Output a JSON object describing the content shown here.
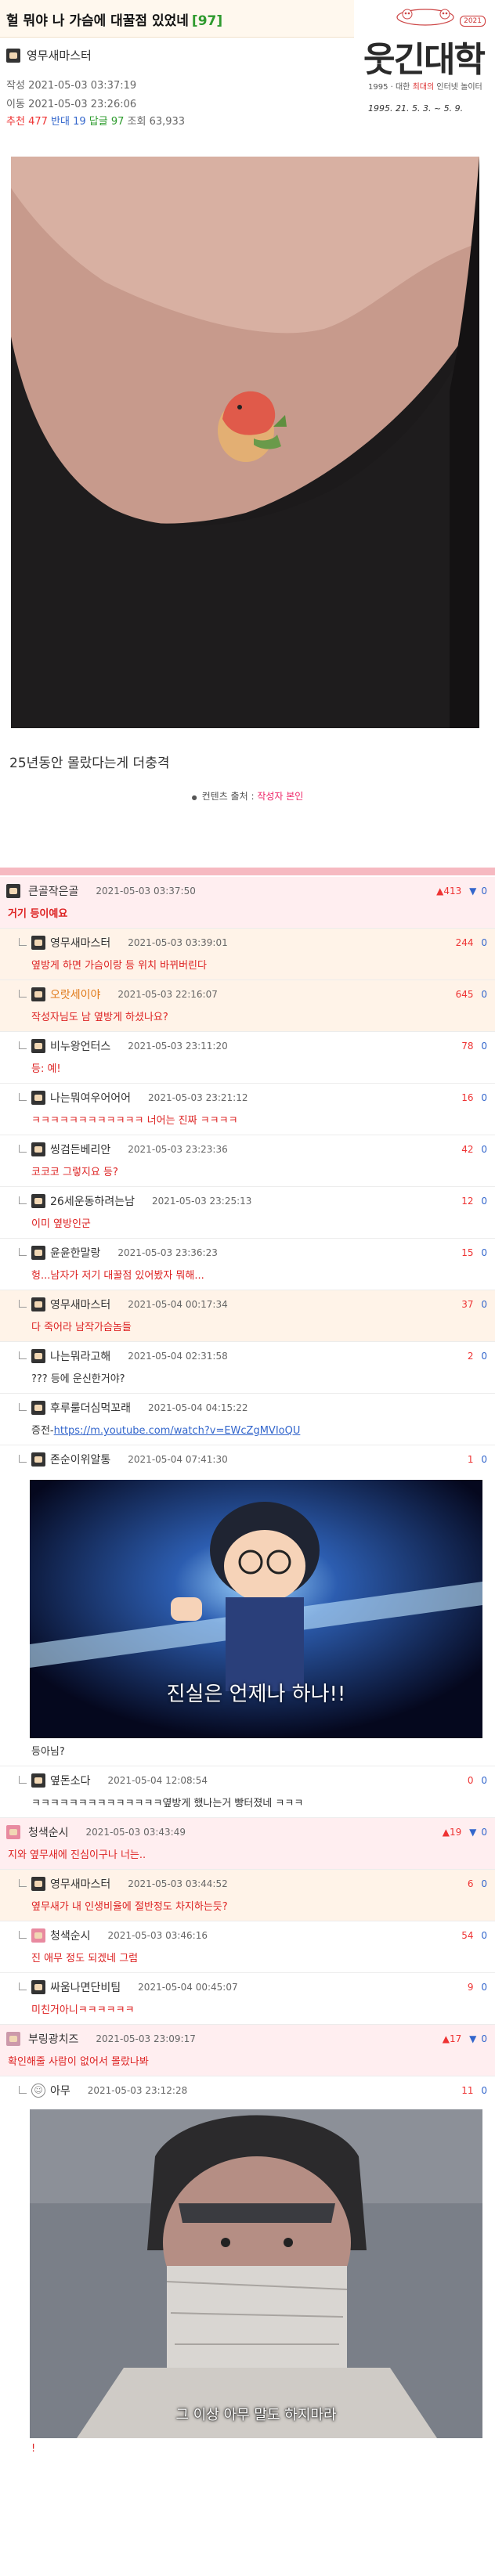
{
  "post": {
    "title": "헐 뭐야 나 가슴에 대꿀점 있었네",
    "comment_count": "[97]",
    "author": "영무새마스터",
    "created_label": "작성",
    "created": "2021-05-03 03:37:19",
    "moved_label": "이동",
    "moved": "2021-05-03 23:26:06",
    "recommend_label": "추천",
    "recommend": "477",
    "oppose_label": "반대",
    "oppose": "19",
    "reply_label": "답글",
    "reply": "97",
    "views_label": "조회",
    "views": "63,933",
    "caption": "25년동안 몰랐다는게 더충격",
    "source_label": "컨텐츠 출처 :",
    "source_value": "작성자 본인"
  },
  "logo": {
    "name": "웃긴대학",
    "badge": "2021",
    "slogan_pre": "1995 · 대한 ",
    "slogan_red": "최대의",
    "slogan_post": " 인터넷 놀이터",
    "date": "1995. 21. 5. 3. ~ 5. 9."
  },
  "comments": [
    {
      "nick": "큰골작은골",
      "time": "2021-05-03 03:37:50",
      "up": "413",
      "down": "0",
      "text": "거기 등이예요",
      "kind": "best"
    },
    {
      "nick": "영무새마스터",
      "time": "2021-05-03 03:39:01",
      "up": "244",
      "down": "0",
      "text": "옆방게 하면 가슴이랑 등 위치 바뀌버린다",
      "kind": "reply"
    },
    {
      "nick": "오랏세이야",
      "time": "2021-05-03 22:16:07",
      "up": "645",
      "down": "0",
      "text": "작성자님도 남 옆방게 하셨나요?",
      "kind": "reply"
    },
    {
      "nick": "비누왕언터스",
      "time": "2021-05-03 23:11:20",
      "up": "78",
      "down": "0",
      "text": "등: 예!",
      "kind": "plain"
    },
    {
      "nick": "나는뭐여우어어어",
      "time": "2021-05-03 23:21:12",
      "up": "16",
      "down": "0",
      "text": "ㅋㅋㅋㅋㅋㅋㅋㅋㅋㅋㅋㅋ 너어는 진짜 ㅋㅋㅋㅋ",
      "kind": "plain"
    },
    {
      "nick": "씽검든베리안",
      "time": "2021-05-03 23:23:36",
      "up": "42",
      "down": "0",
      "text": "코코코 그렇지요 등?",
      "kind": "plain"
    },
    {
      "nick": "26세운동하려는남",
      "time": "2021-05-03 23:25:13",
      "up": "12",
      "down": "0",
      "text": "이미 옆방인군",
      "kind": "plain"
    },
    {
      "nick": "윤윤한말랑",
      "time": "2021-05-03 23:36:23",
      "up": "15",
      "down": "0",
      "text": "헝...남자가 저기 대꿀점 있어봤자 뭐해...",
      "kind": "plain"
    },
    {
      "nick": "영무새마스터",
      "time": "2021-05-04 00:17:34",
      "up": "37",
      "down": "0",
      "text": "다 죽어라 남작가슴놈들",
      "kind": "reply"
    },
    {
      "nick": "나는뭐라고해",
      "time": "2021-05-04 02:31:58",
      "up": "2",
      "down": "0",
      "text": "??? 등에 운신한거야?",
      "kind": "plain2"
    },
    {
      "nick": "후루룰더심먹꼬래",
      "time": "2021-05-04 04:15:22",
      "up": "",
      "down": "",
      "text_pre": "증전-",
      "link": "https://m.youtube.com/watch?v=EWcZgMVIoQU",
      "kind": "link"
    },
    {
      "nick": "존순이위알통",
      "time": "2021-05-04 07:41:30",
      "up": "1",
      "down": "0",
      "text": "등아님?",
      "image_sub": "진실은 언제나 하나!!",
      "kind": "conan"
    },
    {
      "nick": "옆돈소다",
      "time": "2021-05-04 12:08:54",
      "up": "0",
      "down": "0",
      "text": "ㅋㅋㅋㅋㅋㅋㅋㅋㅋㅋㅋㅋㅋㅋ옆방게 했나는거 빵터졌네 ㅋㅋㅋ",
      "kind": "plain2"
    },
    {
      "nick": "청색순시",
      "time": "2021-05-03 03:43:49",
      "up": "19",
      "down": "0",
      "text": "지와 옆무새에 진심이구나 너는..",
      "kind": "best"
    },
    {
      "nick": "영무새마스터",
      "time": "2021-05-03 03:44:52",
      "up": "6",
      "down": "0",
      "text": "옆무새가 내 인생비율에 절반정도 차지하는듯?",
      "kind": "reply"
    },
    {
      "nick": "청색순시",
      "time": "2021-05-03 03:46:16",
      "up": "54",
      "down": "0",
      "text": "진 애무 정도 되겠네 그럼",
      "kind": "plain"
    },
    {
      "nick": "싸움나면단비팀",
      "time": "2021-05-04 00:45:07",
      "up": "9",
      "down": "0",
      "text": "미친거아니ㅋㅋㅋㅋㅋㅋ",
      "kind": "plain"
    },
    {
      "nick": "부링광치즈",
      "time": "2021-05-03 23:09:17",
      "up": "17",
      "down": "0",
      "text": "확인해줄 사람이 없어서 몰랐나봐",
      "kind": "best"
    },
    {
      "nick": "아무",
      "time": "2021-05-03 23:12:28",
      "up": "11",
      "down": "0",
      "text": "!",
      "image_sub": "그 이상 아무 말도 하지마라",
      "kind": "zabuza"
    }
  ],
  "colors": {
    "accent": "#f6b9c1",
    "up": "#e33333",
    "down": "#3366cc",
    "green": "#2e9a2e"
  }
}
